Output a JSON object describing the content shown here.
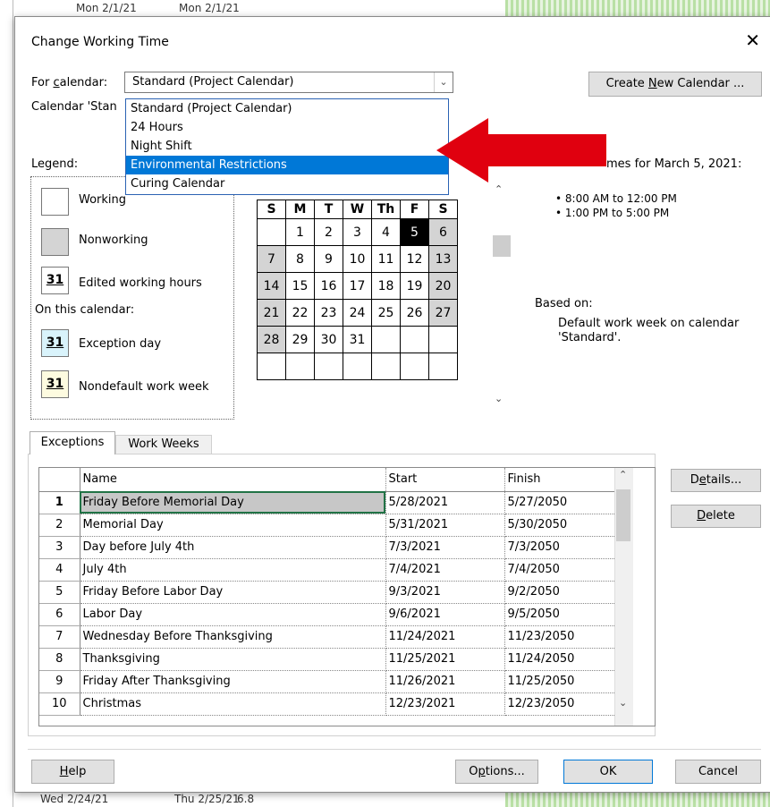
{
  "background": {
    "top_dates": [
      "Mon 2/1/21",
      "Mon 2/1/21"
    ],
    "bottom_dates": [
      "Wed 2/24/21",
      "Thu 2/25/21",
      "6.8"
    ]
  },
  "dialog": {
    "title": "Change Working Time",
    "close_glyph": "✕",
    "for_calendar_label": "For calendar:",
    "calendar_value": "Standard (Project Calendar)",
    "calendar_desc_partial": "Calendar 'Stan",
    "create_new_calendar": "Create New Calendar ...",
    "dropdown_options": [
      {
        "label": "Standard (Project Calendar)",
        "selected": false
      },
      {
        "label": "24 Hours",
        "selected": false
      },
      {
        "label": "Night Shift",
        "selected": false
      },
      {
        "label": "Environmental Restrictions",
        "selected": true
      },
      {
        "label": "Curing Calendar",
        "selected": false
      }
    ]
  },
  "legend": {
    "title": "Legend:",
    "working": "Working",
    "nonworking": "Nonworking",
    "edited": "Edited working hours",
    "on_this_calendar": "On this calendar:",
    "exception": "Exception day",
    "nondefault": "Nondefault work week",
    "swatch_number": "31",
    "colors": {
      "nonworking": "#d4d4d4",
      "exception": "#d9f3fb",
      "nondefault": "#fdfbe0"
    }
  },
  "calendar": {
    "days": [
      "S",
      "M",
      "T",
      "W",
      "Th",
      "F",
      "S"
    ],
    "weeks": [
      [
        "",
        "1",
        "2",
        "3",
        "4",
        "5",
        "6"
      ],
      [
        "7",
        "8",
        "9",
        "10",
        "11",
        "12",
        "13"
      ],
      [
        "14",
        "15",
        "16",
        "17",
        "18",
        "19",
        "20"
      ],
      [
        "21",
        "22",
        "23",
        "24",
        "25",
        "26",
        "27"
      ],
      [
        "28",
        "29",
        "30",
        "31",
        "",
        "",
        ""
      ],
      [
        "",
        "",
        "",
        "",
        "",
        "",
        ""
      ]
    ],
    "selected_day": "5"
  },
  "working_times": {
    "header_partial": "mes for March 5, 2021:",
    "times": [
      "• 8:00 AM to 12:00 PM",
      "• 1:00 PM to 5:00 PM"
    ],
    "based_on_label": "Based on:",
    "based_on_text": "Default work week on calendar",
    "based_on_text2": "'Standard'."
  },
  "tabs": [
    {
      "label": "Exceptions",
      "active": true
    },
    {
      "label": "Work Weeks",
      "active": false
    }
  ],
  "grid": {
    "columns": [
      "Name",
      "Start",
      "Finish"
    ],
    "rows": [
      {
        "num": "1",
        "name": "Friday Before Memorial Day",
        "start": "5/28/2021",
        "finish": "5/27/2050"
      },
      {
        "num": "2",
        "name": "Memorial Day",
        "start": "5/31/2021",
        "finish": "5/30/2050"
      },
      {
        "num": "3",
        "name": "Day before July 4th",
        "start": "7/3/2021",
        "finish": "7/3/2050"
      },
      {
        "num": "4",
        "name": "July 4th",
        "start": "7/4/2021",
        "finish": "7/4/2050"
      },
      {
        "num": "5",
        "name": "Friday Before Labor Day",
        "start": "9/3/2021",
        "finish": "9/2/2050"
      },
      {
        "num": "6",
        "name": "Labor Day",
        "start": "9/6/2021",
        "finish": "9/5/2050"
      },
      {
        "num": "7",
        "name": "Wednesday Before Thanksgiving",
        "start": "11/24/2021",
        "finish": "11/23/2050"
      },
      {
        "num": "8",
        "name": "Thanksgiving",
        "start": "11/25/2021",
        "finish": "11/24/2050"
      },
      {
        "num": "9",
        "name": "Friday After Thanksgiving",
        "start": "11/26/2021",
        "finish": "11/25/2050"
      },
      {
        "num": "10",
        "name": "Christmas",
        "start": "12/23/2021",
        "finish": "12/23/2050"
      }
    ]
  },
  "buttons": {
    "details": "Details...",
    "delete": "Delete",
    "help": "Help",
    "options": "Options...",
    "ok": "OK",
    "cancel": "Cancel"
  },
  "colors": {
    "accent": "#0078d7",
    "arrow": "#e0000f",
    "grid_select": "#217346"
  }
}
